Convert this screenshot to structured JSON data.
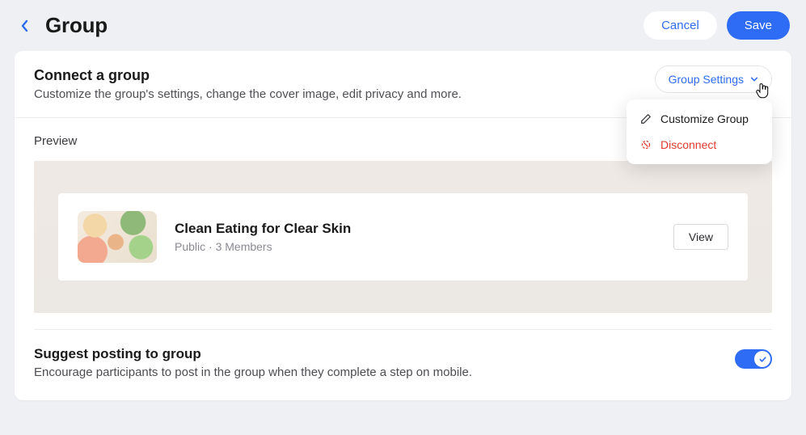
{
  "header": {
    "title": "Group",
    "cancel_label": "Cancel",
    "save_label": "Save"
  },
  "connect": {
    "heading": "Connect a group",
    "sub": "Customize the group's settings, change the cover image, edit privacy and more.",
    "settings_button": "Group Settings",
    "dropdown": {
      "customize": "Customize Group",
      "disconnect": "Disconnect"
    }
  },
  "preview": {
    "label": "Preview",
    "group_name": "Clean Eating for Clear Skin",
    "group_meta": "Public · 3 Members",
    "view_label": "View"
  },
  "suggest": {
    "heading": "Suggest posting to group",
    "sub": "Encourage participants to post in the group when they complete a step on mobile.",
    "enabled": true
  }
}
